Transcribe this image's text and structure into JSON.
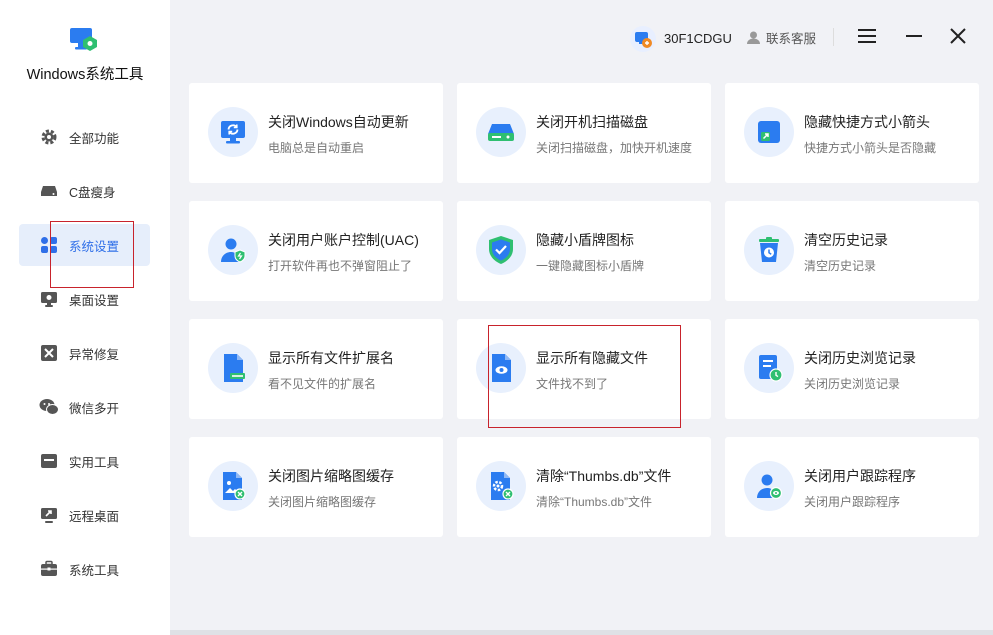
{
  "app": {
    "title": "Windows系统工具"
  },
  "topbar": {
    "user_id": "30F1CDGU",
    "service_label": "联系客服"
  },
  "sidebar": {
    "items": [
      {
        "label": "全部功能",
        "icon": "gear-icon"
      },
      {
        "label": "C盘瘦身",
        "icon": "drive-icon"
      },
      {
        "label": "系统设置",
        "icon": "grid-icon",
        "active": true
      },
      {
        "label": "桌面设置",
        "icon": "monitor-icon"
      },
      {
        "label": "异常修复",
        "icon": "tools-icon"
      },
      {
        "label": "微信多开",
        "icon": "wechat-icon"
      },
      {
        "label": "实用工具",
        "icon": "toolbox-icon"
      },
      {
        "label": "远程桌面",
        "icon": "remote-desktop-icon"
      },
      {
        "label": "系统工具",
        "icon": "briefcase-icon"
      }
    ]
  },
  "cards": [
    {
      "title": "关闭Windows自动更新",
      "desc": "电脑总是自动重启",
      "icon": "monitor-refresh-icon"
    },
    {
      "title": "关闭开机扫描磁盘",
      "desc": "关闭扫描磁盘，加快开机速度",
      "icon": "hard-disk-icon"
    },
    {
      "title": "隐藏快捷方式小箭头",
      "desc": "快捷方式小箭头是否隐藏",
      "icon": "shortcut-arrow-icon"
    },
    {
      "title": "关闭用户账户控制(UAC)",
      "desc": "打开软件再也不弹窗阻止了",
      "icon": "user-shield-icon"
    },
    {
      "title": "隐藏小盾牌图标",
      "desc": "一键隐藏图标小盾牌",
      "icon": "shield-check-icon"
    },
    {
      "title": "清空历史记录",
      "desc": "清空历史记录",
      "icon": "trash-history-icon"
    },
    {
      "title": "显示所有文件扩展名",
      "desc": "看不见文件的扩展名",
      "icon": "file-extension-icon"
    },
    {
      "title": "显示所有隐藏文件",
      "desc": "文件找不到了",
      "icon": "file-eye-icon"
    },
    {
      "title": "关闭历史浏览记录",
      "desc": "关闭历史浏览记录",
      "icon": "document-clock-icon"
    },
    {
      "title": "关闭图片缩略图缓存",
      "desc": "关闭图片缩略图缓存",
      "icon": "image-file-icon"
    },
    {
      "title": "清除“Thumbs.db”文件",
      "desc": "清除“Thumbs.db”文件",
      "icon": "file-settings-icon"
    },
    {
      "title": "关闭用户跟踪程序",
      "desc": "关闭用户跟踪程序",
      "icon": "user-eye-icon"
    }
  ],
  "colors": {
    "accent": "#2f6fe8",
    "icon_blue": "#2b7cf0",
    "icon_green": "#2fbf71",
    "highlight": "#c8232c"
  }
}
